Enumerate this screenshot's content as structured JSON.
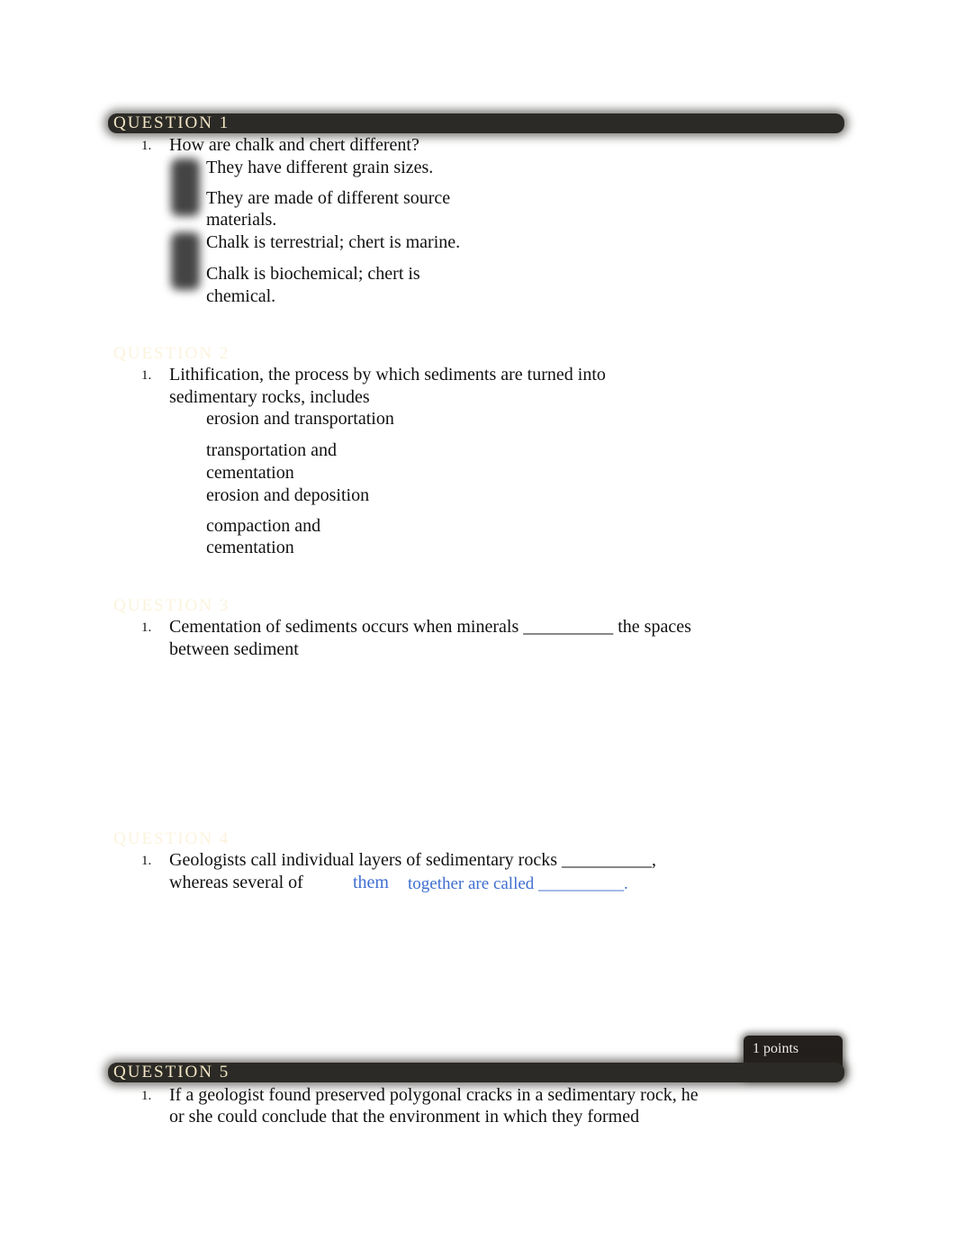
{
  "questions": [
    {
      "title": "QUESTION 1",
      "number": "1.",
      "prompt": "How are chalk and chert different?",
      "options": [
        "They have different grain sizes.",
        "They are made of different source materials.",
        "Chalk is terrestrial; chert is marine.",
        "Chalk is biochemical; chert is chemical."
      ]
    },
    {
      "title": "QUESTION 2",
      "number": "1.",
      "prompt": "Lithification, the process by which sediments are turned into sedimentary rocks, includes",
      "options": [
        "erosion and transportation",
        "transportation and cementation",
        "erosion and deposition",
        "compaction and cementation"
      ]
    },
    {
      "title": "QUESTION 3",
      "number": "1.",
      "prompt": "Cementation of sediments occurs when minerals __________ the spaces between sediment"
    },
    {
      "title": "QUESTION 4",
      "number": "1.",
      "prompt_line1": "Geologists call individual layers of sedimentary rocks __________,",
      "prompt_line2a": "whereas several of",
      "prompt_line2b": "them",
      "prompt_line2c": "together are called __________."
    },
    {
      "title": "QUESTION 5",
      "number": "1.",
      "points": "1 points",
      "prompt": "If a geologist found preserved polygonal cracks in a sedimentary rock, he or she could conclude that the environment in which they formed"
    }
  ],
  "colors": {
    "header_bar": "#2b2a26",
    "header_text": "#f3e6c6",
    "link_blue": "#3f6fd1"
  }
}
